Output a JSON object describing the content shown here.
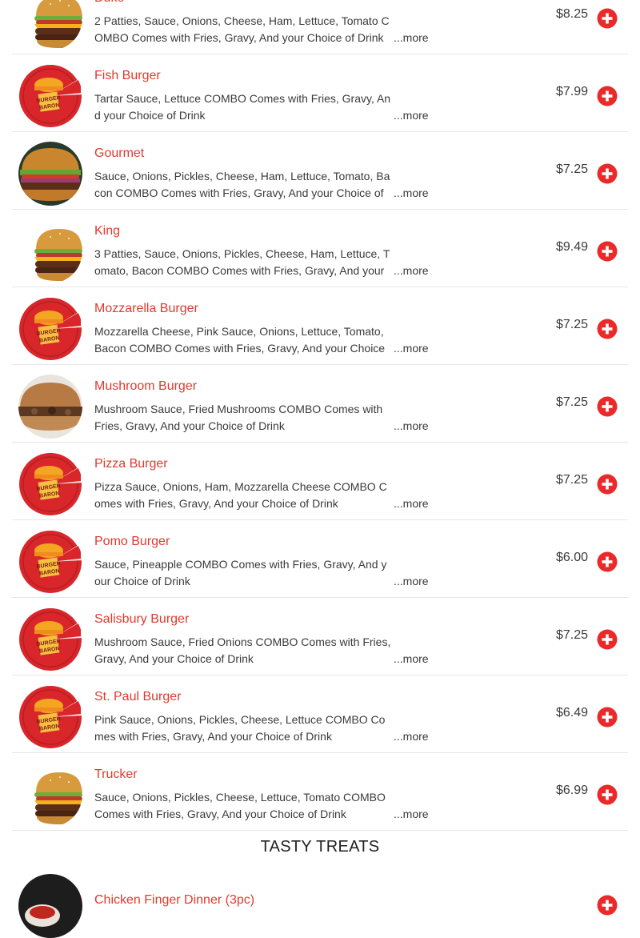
{
  "colors": {
    "accent": "#e03a2e",
    "add_button": "#ea2a2a",
    "text": "#3a3a3a",
    "divider": "#e6e6e6"
  },
  "more_label": "...more",
  "items": [
    {
      "name": "Duke",
      "desc": "2 Patties, Sauce, Onions, Cheese, Ham, Lettuce, Tomato COMBO Comes with Fries, Gravy, And your Choice of Drink",
      "price": "$8.25",
      "image": "double-burger"
    },
    {
      "name": "Fish Burger",
      "desc": "Tartar Sauce, Lettuce COMBO Comes with Fries, Gravy, And your Choice of Drink",
      "price": "$7.99",
      "image": "burger-baron-logo"
    },
    {
      "name": "Gourmet",
      "desc": "Sauce, Onions, Pickles, Cheese, Ham, Lettuce, Tomato, Bacon COMBO Comes with Fries, Gravy, And your Choice of Drink",
      "price": "$7.25",
      "image": "gourmet-burger"
    },
    {
      "name": "King",
      "desc": "3 Patties, Sauce, Onions, Pickles, Cheese, Ham, Lettuce, Tomato, Bacon COMBO Comes with Fries, Gravy, And your Choice of Drink",
      "price": "$9.49",
      "image": "double-burger"
    },
    {
      "name": "Mozzarella Burger",
      "desc": "Mozzarella Cheese, Pink Sauce, Onions, Lettuce, Tomato, Bacon COMBO Comes with Fries, Gravy, And your Choice of Drink",
      "price": "$7.25",
      "image": "burger-baron-logo"
    },
    {
      "name": "Mushroom Burger",
      "desc": "Mushroom Sauce, Fried Mushrooms COMBO Comes with Fries, Gravy, And your Choice of Drink",
      "price": "$7.25",
      "image": "mushroom-burger"
    },
    {
      "name": "Pizza Burger",
      "desc": "Pizza Sauce, Onions, Ham, Mozzarella Cheese COMBO Comes with Fries, Gravy, And your Choice of Drink",
      "price": "$7.25",
      "image": "burger-baron-logo"
    },
    {
      "name": "Pomo Burger",
      "desc": "Sauce, Pineapple COMBO Comes with Fries, Gravy, And your Choice of Drink",
      "price": "$6.00",
      "image": "burger-baron-logo"
    },
    {
      "name": "Salisbury Burger",
      "desc": "Mushroom Sauce, Fried Onions COMBO Comes with Fries, Gravy, And your Choice of Drink",
      "price": "$7.25",
      "image": "burger-baron-logo"
    },
    {
      "name": "St. Paul Burger",
      "desc": "Pink Sauce, Onions, Pickles, Cheese, Lettuce COMBO Comes with Fries, Gravy, And your Choice of Drink",
      "price": "$6.49",
      "image": "burger-baron-logo"
    },
    {
      "name": "Trucker",
      "desc": "Sauce, Onions, Pickles, Cheese, Lettuce, Tomato COMBO Comes with Fries, Gravy, And your Choice of Drink",
      "price": "$6.99",
      "image": "double-burger"
    }
  ],
  "section": {
    "title": "TASTY TREATS"
  },
  "partial_item": {
    "name": "Chicken Finger Dinner (3pc)",
    "image": "chicken-dish"
  }
}
